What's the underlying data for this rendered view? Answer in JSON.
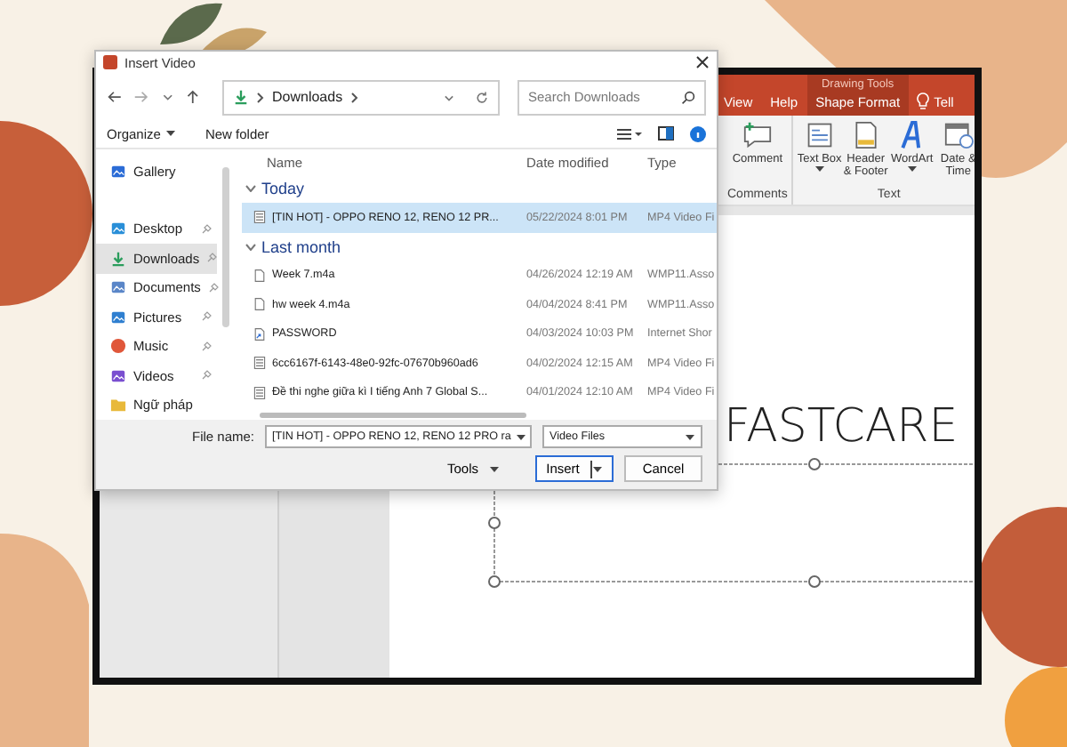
{
  "dialog": {
    "title": "Insert Video",
    "address": [
      "Downloads"
    ],
    "search": {
      "placeholder": "Search Downloads"
    },
    "toolbar": [
      "Organize",
      "New folder"
    ],
    "nav_items": [
      {
        "label": "Gallery",
        "kind": "gallery",
        "selected": false
      },
      {
        "label": "Desktop",
        "kind": "desktop",
        "selected": false
      },
      {
        "label": "Downloads",
        "kind": "downloads",
        "selected": true
      },
      {
        "label": "Documents",
        "kind": "documents",
        "selected": false
      },
      {
        "label": "Pictures",
        "kind": "pictures",
        "selected": false
      },
      {
        "label": "Music",
        "kind": "music",
        "selected": false
      },
      {
        "label": "Videos",
        "kind": "videos",
        "selected": false
      },
      {
        "label": "Ngữ pháp",
        "kind": "folder",
        "selected": false
      }
    ],
    "columns": [
      "Name",
      "Date modified",
      "Type"
    ],
    "groups": [
      {
        "label": "Today",
        "rows": [
          {
            "name": "[TIN HOT] - OPPO RENO 12, RENO 12 PR...",
            "date": "05/22/2024 8:01 PM",
            "type": "MP4 Video Fi",
            "kind": "video",
            "selected": true
          }
        ]
      },
      {
        "label": "Last month",
        "rows": [
          {
            "name": "Week 7.m4a",
            "date": "04/26/2024 12:19 AM",
            "type": "WMP11.Asso",
            "kind": "audio",
            "selected": false
          },
          {
            "name": "hw week 4.m4a",
            "date": "04/04/2024 8:41 PM",
            "type": "WMP11.Asso",
            "kind": "audio",
            "selected": false
          },
          {
            "name": "PASSWORD",
            "date": "04/03/2024 10:03 PM",
            "type": "Internet Shor",
            "kind": "shortcut",
            "selected": false
          },
          {
            "name": "6cc6167f-6143-48e0-92fc-07670b960ad6",
            "date": "04/02/2024 12:15 AM",
            "type": "MP4 Video Fi",
            "kind": "video",
            "selected": false
          },
          {
            "name": "Đề thi nghe giữa kì I tiếng Anh 7 Global S...",
            "date": "04/01/2024 12:10 AM",
            "type": "MP4 Video Fi",
            "kind": "video",
            "selected": false
          }
        ]
      }
    ],
    "file_name_label": "File name:",
    "file_name": "[TIN HOT] - OPPO RENO 12, RENO 12 PRO ra",
    "file_type": "Video Files",
    "tools": "Tools",
    "insert": "Insert",
    "cancel": "Cancel"
  },
  "ribbon": {
    "context_label": "Drawing Tools",
    "tabs": [
      {
        "label": "View",
        "selected": false
      },
      {
        "label": "Help",
        "selected": false
      },
      {
        "label": "Shape Format",
        "selected": true
      }
    ],
    "tell_me": "Tell",
    "groups": [
      {
        "label": "Comments",
        "commands": [
          {
            "label": "Comment",
            "kind": "comment",
            "dropdown": false
          }
        ]
      },
      {
        "label": "Text",
        "commands": [
          {
            "label": "Text Box",
            "kind": "textbox",
            "dropdown": true
          },
          {
            "label": "Header & Footer",
            "kind": "header",
            "dropdown": false
          },
          {
            "label": "WordArt",
            "kind": "wordart",
            "dropdown": true
          },
          {
            "label": "Date & Time",
            "kind": "date",
            "dropdown": false
          }
        ]
      }
    ]
  },
  "slide": {
    "title_text": "FASTCARE"
  }
}
